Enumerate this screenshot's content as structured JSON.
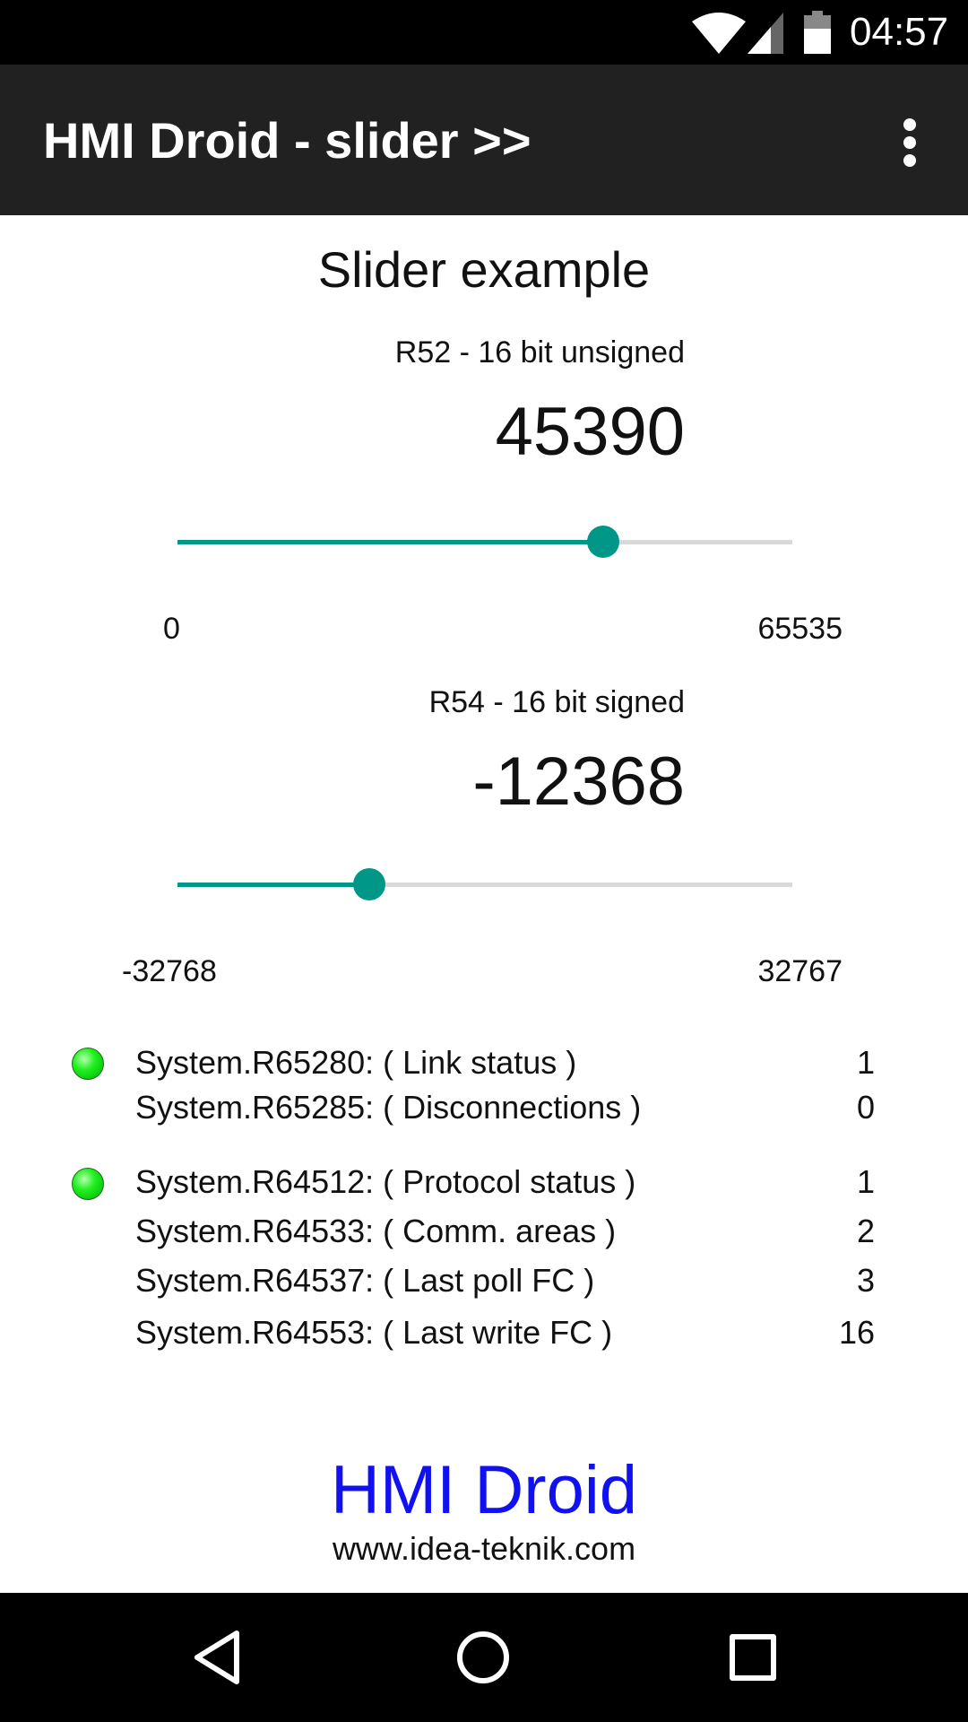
{
  "status_bar": {
    "time": "04:57",
    "icons": [
      "wifi-icon",
      "cell-signal-icon",
      "battery-icon"
    ]
  },
  "app_bar": {
    "title": "HMI Droid - slider >>",
    "overflow_icon": "more-vert-icon"
  },
  "page": {
    "title": "Slider example"
  },
  "sliders": [
    {
      "label": "R52 - 16 bit unsigned",
      "value": "45390",
      "min_label": "0",
      "max_label": "65535",
      "min": 0,
      "max": 65535,
      "current": 45390
    },
    {
      "label": "R54 - 16 bit signed",
      "value": "-12368",
      "min_label": "-32768",
      "max_label": "32767",
      "min": -32768,
      "max": 32767,
      "current": -12368
    }
  ],
  "system": [
    {
      "label": "System.R65280: ( Link status )",
      "value": "1",
      "led": "on"
    },
    {
      "label": "System.R65285: ( Disconnections )",
      "value": "0"
    },
    {
      "label": "System.R64512: ( Protocol status )",
      "value": "1",
      "led": "on"
    },
    {
      "label": "System.R64533: ( Comm. areas )",
      "value": "2"
    },
    {
      "label": "System.R64537: ( Last poll FC )",
      "value": "3"
    },
    {
      "label": "System.R64553: ( Last write FC )",
      "value": "16"
    }
  ],
  "footer": {
    "brand": "HMI Droid",
    "url": "www.idea-teknik.com"
  },
  "colors": {
    "accent": "#009688",
    "app_bar": "#212121",
    "brand": "#1010f0",
    "led_on": "#20f020"
  },
  "nav_bar": {
    "icons": [
      "back-icon",
      "home-icon",
      "recent-apps-icon"
    ]
  }
}
